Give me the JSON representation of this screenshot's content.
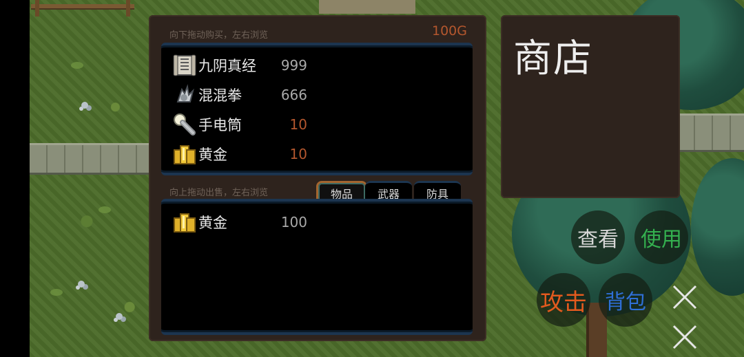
{
  "shop": {
    "buy_hint": "向下拖动购买，左右浏览",
    "sell_hint": "向上拖动出售，左右浏览",
    "gold": "100G",
    "buy_items": [
      {
        "name": "九阴真经",
        "price": "999",
        "icon": "scroll-icon",
        "price_color": "white"
      },
      {
        "name": "混混拳",
        "price": "666",
        "icon": "fist-icon",
        "price_color": "white"
      },
      {
        "name": "手电筒",
        "price": "10",
        "icon": "flashlight-icon",
        "price_color": "orange"
      },
      {
        "name": "黄金",
        "price": "10",
        "icon": "gold-bars-icon",
        "price_color": "orange"
      }
    ],
    "sell_items": [
      {
        "name": "黄金",
        "price": "100",
        "icon": "gold-bars-icon"
      }
    ],
    "tabs": [
      {
        "label": "物品",
        "selected": true
      },
      {
        "label": "武器",
        "selected": false
      },
      {
        "label": "防具",
        "selected": false
      }
    ],
    "title": "商店"
  },
  "actions": {
    "view": "查看",
    "use": "使用",
    "attack": "攻击",
    "bag": "背包"
  },
  "colors": {
    "gold_text": "#b4572e",
    "use_button": "#34b04f",
    "attack_button": "#e25a1e",
    "bag_button": "#2f6fd6"
  }
}
